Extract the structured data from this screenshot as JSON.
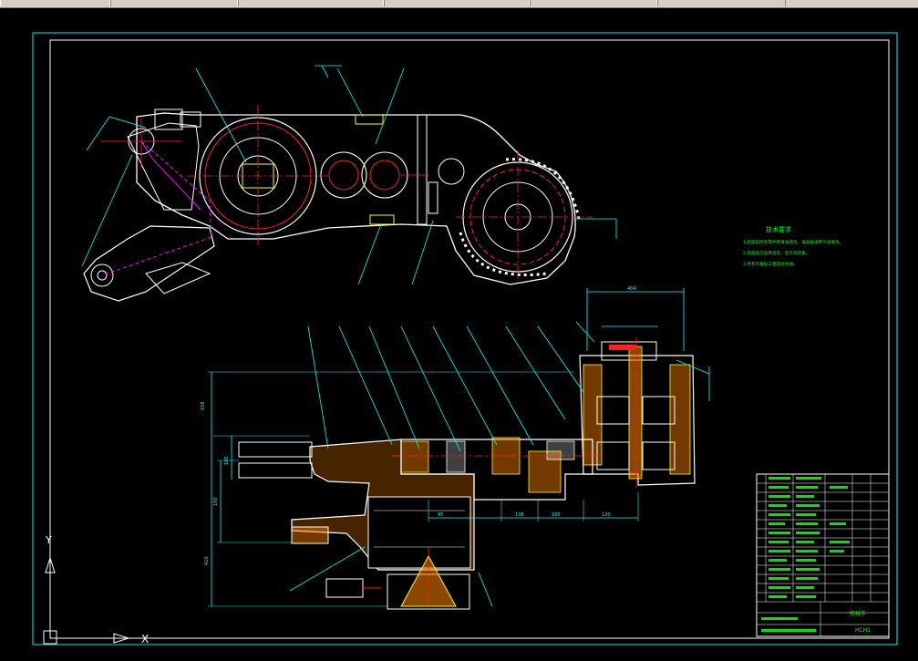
{
  "app": {
    "toolbar_segments": 6
  },
  "drawing": {
    "tech_req_title": "技术要求",
    "tech_req_lines": [
      "1.装配前所有零件用煤油清洗，滚动轴承用汽油清洗。",
      "2.装配后应运转灵活，无卡滞现象。",
      "3.所有外露加工面涂防锈油。"
    ],
    "dims": {
      "top_width": "404",
      "d1": "120",
      "d2": "228",
      "d3": "410",
      "d4": "160",
      "d5": "100",
      "d6": "95",
      "d7": "138",
      "d8": "105"
    },
    "title_block_name": "机械手",
    "title_block_no": "HCH1",
    "ucs_x": "X",
    "ucs_y": "Y"
  },
  "colors": {
    "background": "#000000",
    "border": "#00c8c8",
    "outline": "#ffffff",
    "center": "#ff2020",
    "dim": "#00ffff",
    "hatch": "#ff8000",
    "part": "#ffff00",
    "leader": "#00ffff",
    "magenta": "#ff00ff",
    "green": "#00ff00"
  }
}
